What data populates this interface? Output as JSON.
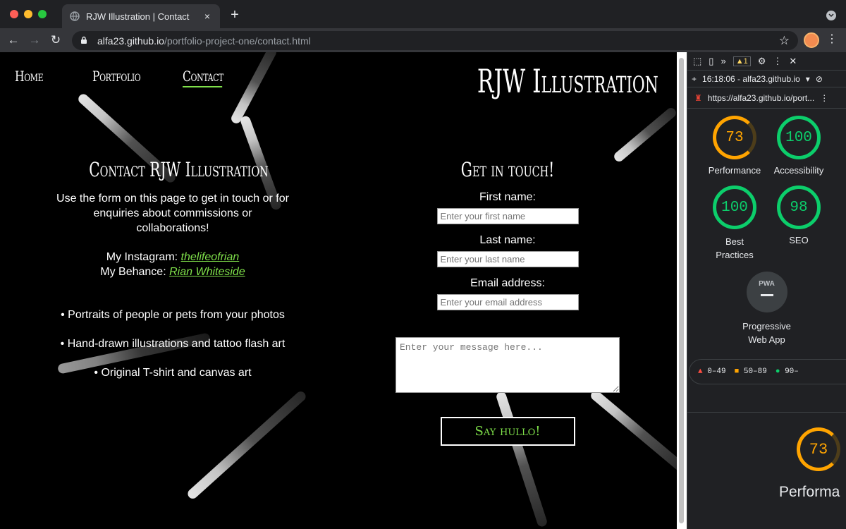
{
  "browser": {
    "tab_title": "RJW Illustration | Contact",
    "tab_close": "×",
    "new_tab": "+",
    "url_host": "alfa23.github.io",
    "url_path": "/portfolio-project-one/contact.html"
  },
  "site": {
    "nav": [
      {
        "label": "Home"
      },
      {
        "label": "Portfolio"
      },
      {
        "label": "Contact"
      }
    ],
    "brand": "RJW Illustration",
    "left": {
      "heading": "Contact RJW Illustration",
      "intro": "Use the form on this page to get in touch or for enquiries about commissions or collaborations!",
      "instagram_label": "My Instagram:",
      "instagram_handle": "thelifeofrian",
      "behance_label": "My Behance:",
      "behance_handle": "Rian Whiteside",
      "services": [
        "• Portraits of people or pets from your photos",
        "• Hand-drawn illustrations and tattoo flash art",
        "• Original T-shirt and canvas art"
      ]
    },
    "form": {
      "heading": "Get in touch!",
      "first_label": "First name:",
      "first_placeholder": "Enter your first name",
      "last_label": "Last name:",
      "last_placeholder": "Enter your last name",
      "email_label": "Email address:",
      "email_placeholder": "Enter your email address",
      "message_placeholder": "Enter your message here...",
      "submit": "Say hullo!"
    }
  },
  "devtools": {
    "warning_count": "1",
    "report_time": "16:18:06 - alfa23.github.io",
    "report_url": "https://alfa23.github.io/port...",
    "scores": [
      {
        "value": "73",
        "label": "Performance",
        "color": "#ffa400"
      },
      {
        "value": "100",
        "label": "Accessibility",
        "color": "#0cce6b"
      },
      {
        "value": "100",
        "label": "Best Practices",
        "color": "#0cce6b"
      },
      {
        "value": "98",
        "label": "SEO",
        "color": "#0cce6b"
      }
    ],
    "pwa_badge": "PWA",
    "pwa_label": "Progressive Web App",
    "legend": [
      "0–49",
      "50–89",
      "90–"
    ],
    "bottom_score": "73",
    "bottom_label": "Performa"
  }
}
